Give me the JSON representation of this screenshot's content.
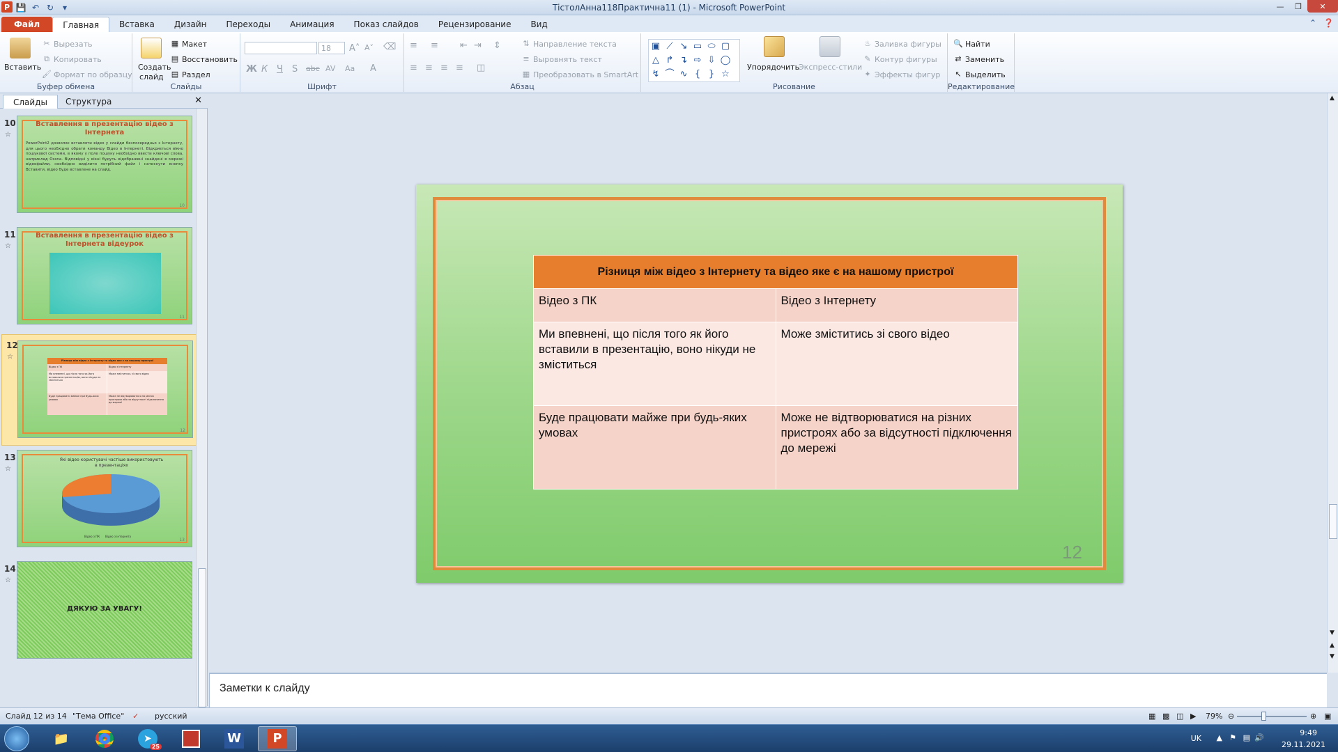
{
  "window": {
    "title": "ТістолАнна118Практична11 (1)  -  Microsoft PowerPoint"
  },
  "tabs": [
    {
      "label": "Файл"
    },
    {
      "label": "Главная"
    },
    {
      "label": "Вставка"
    },
    {
      "label": "Дизайн"
    },
    {
      "label": "Переходы"
    },
    {
      "label": "Анимация"
    },
    {
      "label": "Показ слайдов"
    },
    {
      "label": "Рецензирование"
    },
    {
      "label": "Вид"
    }
  ],
  "ribbon": {
    "clipboard": {
      "paste": "Вставить",
      "cut": "Вырезать",
      "copy": "Копировать",
      "format": "Формат по образцу",
      "label": "Буфер обмена"
    },
    "slides": {
      "new_slide_1": "Создать",
      "new_slide_2": "слайд",
      "layout": "Макет",
      "reset": "Восстановить",
      "section": "Раздел",
      "label": "Слайды"
    },
    "font": {
      "size": "18",
      "label": "Шрифт",
      "bold": "Ж",
      "italic": "К",
      "underline": "Ч",
      "strike": "S",
      "abc": "abc",
      "spacing": "AV",
      "case": "Aa",
      "color": "A"
    },
    "paragraph": {
      "text_dir": "Направление текста",
      "align_text": "Выровнять текст",
      "smartart": "Преобразовать в SmartArt",
      "label": "Абзац"
    },
    "drawing": {
      "arrange": "Упорядочить",
      "quick_styles": "Экспресс-стили",
      "fill": "Заливка фигуры",
      "outline": "Контур фигуры",
      "effects": "Эффекты фигур",
      "label": "Рисование"
    },
    "editing": {
      "find": "Найти",
      "replace": "Заменить",
      "select": "Выделить",
      "label": "Редактирование"
    }
  },
  "left_pane": {
    "tabs": {
      "slides": "Слайды",
      "outline": "Структура"
    },
    "thumbs": [
      {
        "num": "10",
        "title": "Вставлення  в презентацію відео з Інтернета",
        "text": "PowerPoint2 дозволяє вставляти відео у слайди безпосередньо з Інтернету, для цього необхідно обрати команду Відео в Інтернеті. Відкриється вікно пошукової системи, в якому у поле пошуку необхідно ввести ключові слова, наприклад Ossna. Відповідні у вікні будуть відображені знайдені в мережі відеофайли, необхідно виділити потрібний файл і натиснути кнопку Вставити, відео буде вставлене на слайд.",
        "pn": "10"
      },
      {
        "num": "11",
        "title": "Вставлення  в презентацію відео з Інтернета відеурок",
        "pn": "11"
      },
      {
        "num": "12",
        "title": "Різниця між відео з Інтернету та відео яке є на нашому пристрої",
        "row1a": "Відео з ПК",
        "row1b": "Відео з Інтернету",
        "row2a": "Ми впевнені, що після того як його вставили в презентацію, воно нікуди не зміститься",
        "row2b": "Може зміститись зі свого відео",
        "row3a": "Буде працювати майже при будь-яких умовах",
        "row3b": "Може не відтворюватися на різних пристроях або за відсутності підключення до мережі",
        "pn": "12"
      },
      {
        "num": "13",
        "title": "Які відео користувачі частіше використовують в презентаціях",
        "legend1": "Відео з ПК",
        "legend2": "Відео з інтернету",
        "pn": "13"
      },
      {
        "num": "14",
        "title": "ДЯКУЮ ЗА УВАГУ!"
      }
    ]
  },
  "slide": {
    "header": "Різниця між відео з Інтернету та відео яке є на нашому пристрої",
    "rows": [
      [
        "Відео з ПК",
        "Відео з Інтернету"
      ],
      [
        "Ми впевнені, що після того як його вставили в презентацію, воно нікуди не зміститься",
        "Може зміститись зі свого відео"
      ],
      [
        "Буде працювати майже при будь-яких умовах",
        "Може не відтворюватися на різних пристроях або за відсутності підключення до мережі"
      ]
    ],
    "page_number": "12"
  },
  "notes": {
    "placeholder": "Заметки к слайду"
  },
  "status": {
    "slide_info": "Слайд 12 из 14",
    "theme": "\"Тема Office\"",
    "language": "русский",
    "zoom": "79%"
  },
  "taskbar": {
    "lang": "UK",
    "time": "9:49",
    "date": "29.11.2021",
    "telegram_badge": "25"
  },
  "colors": {
    "file_tab": "#d24726",
    "table_header": "#e67e2e",
    "slide_frame": "#e08a3c"
  }
}
